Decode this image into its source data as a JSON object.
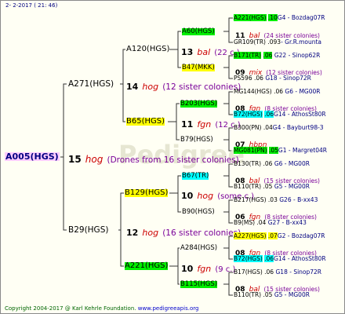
{
  "header": {
    "date": "2-  2-2017 ( 21: 46)"
  },
  "watermark": "Pedigree",
  "footer": {
    "copyright": "Copyright 2004-2017 @ Karl Kehrle Foundation.",
    "url": "www.pedigreeapis.org"
  },
  "colors": {
    "green": "#00ee00",
    "yellow": "#ffff00",
    "cyan": "#00ffff",
    "root": "#ffccff",
    "code": "#cc0000",
    "desc": "#7a0099",
    "ref": "#000080"
  },
  "root": {
    "name": "A005(HGS)",
    "num": "15",
    "code": "hog",
    "desc": "(Drones from 16 sister colonies)"
  },
  "gen1": [
    {
      "name": "A271(HGS)",
      "num": "14",
      "code": "hog",
      "desc": "(12 sister colonies)"
    },
    {
      "name": "B29(HGS)",
      "num": "12",
      "code": "hog",
      "desc": "(16 sister colonies)"
    }
  ],
  "gen2": [
    {
      "name": "A120(HGS)"
    },
    {
      "name": "B65(HGS)",
      "num": "11",
      "code": "fgn",
      "desc": "(12 c.)"
    },
    {
      "name": "B129(HGS)",
      "num": "10",
      "code": "hog",
      "desc": "(some c.)"
    },
    {
      "name": "A221(HGS)",
      "num": "10",
      "code": "fgn",
      "desc": "(9 c.)"
    }
  ],
  "a120": {
    "num": "13",
    "code": "bal",
    "desc": "(22 c.)"
  },
  "gen3": [
    {
      "name": "A60(HGS)"
    },
    {
      "name": "B47(MKK)"
    },
    {
      "name": "B203(HGS)"
    },
    {
      "name": "B79(HGS)"
    },
    {
      "name": "B67(TR)"
    },
    {
      "name": "B90(HGS)"
    },
    {
      "name": "A284(HGS)"
    },
    {
      "name": "B115(HGS)"
    }
  ],
  "gen3info": [
    {
      "num": "11",
      "code": "bal",
      "desc": "(24 sister colonies)"
    },
    {
      "num": "09",
      "code": "mix",
      "desc": "(12 sister colonies)"
    },
    {
      "num": "08",
      "code": "fgn",
      "desc": "(8 sister colonies)"
    },
    {
      "num": "07",
      "code": "hbpn",
      "desc": ""
    },
    {
      "num": "08",
      "code": "bal",
      "desc": "(15 sister colonies)"
    },
    {
      "num": "06",
      "code": "fgn",
      "desc": "(8 sister colonies)"
    },
    {
      "num": "08",
      "code": "fgn",
      "desc": "(8 sister colonies)"
    },
    {
      "num": "08",
      "code": "bal",
      "desc": "(15 sister colonies)"
    }
  ],
  "gen4": [
    {
      "name": "A221(HGS)",
      "yr": ".10",
      "ref": "G4 - Bozdag07R"
    },
    {
      "name": "GR109(TR)",
      "yr": ".093",
      "ref": "- Gr.R.mounta"
    },
    {
      "name": "B171(TR)",
      "yr": ".06",
      "ref": "G22 - Sinop62R"
    },
    {
      "name": "PS596",
      "yr": ".06",
      "ref": "G18 - Sinop72R"
    },
    {
      "name": "MG144(HGS)",
      "yr": ".06",
      "ref": "G6 - MG00R"
    },
    {
      "name": "B72(HGS)",
      "yr": ".06",
      "ref": "G14 - AthosSt80R"
    },
    {
      "name": "B300(PN)",
      "yr": ".04",
      "ref": "G4 - Bayburt98-3"
    },
    {
      "name": "MG081(PN)",
      "yr": ".05",
      "ref": "G1 - Margret04R"
    },
    {
      "name": "B130(TR)",
      "yr": ".06",
      "ref": "G6 - MG00R"
    },
    {
      "name": "B110(TR)",
      "yr": ".05",
      "ref": "G5 - MG00R"
    },
    {
      "name": "B217(HGS)",
      "yr": ".03",
      "ref": "G26 - B-xx43"
    },
    {
      "name": "B9(MS)",
      "yr": ".04",
      "ref": "G27 - B-xx43"
    },
    {
      "name": "A227(HGS)",
      "yr": ".07",
      "ref": "G2 - Bozdag07R"
    },
    {
      "name": "B72(HGS)",
      "yr": ".06",
      "ref": "G14 - AthosSt80R"
    },
    {
      "name": "B17(HGS)",
      "yr": ".06",
      "ref": "G18 - Sinop72R"
    },
    {
      "name": "B110(TR)",
      "yr": ".05",
      "ref": "G5 - MG00R"
    }
  ]
}
